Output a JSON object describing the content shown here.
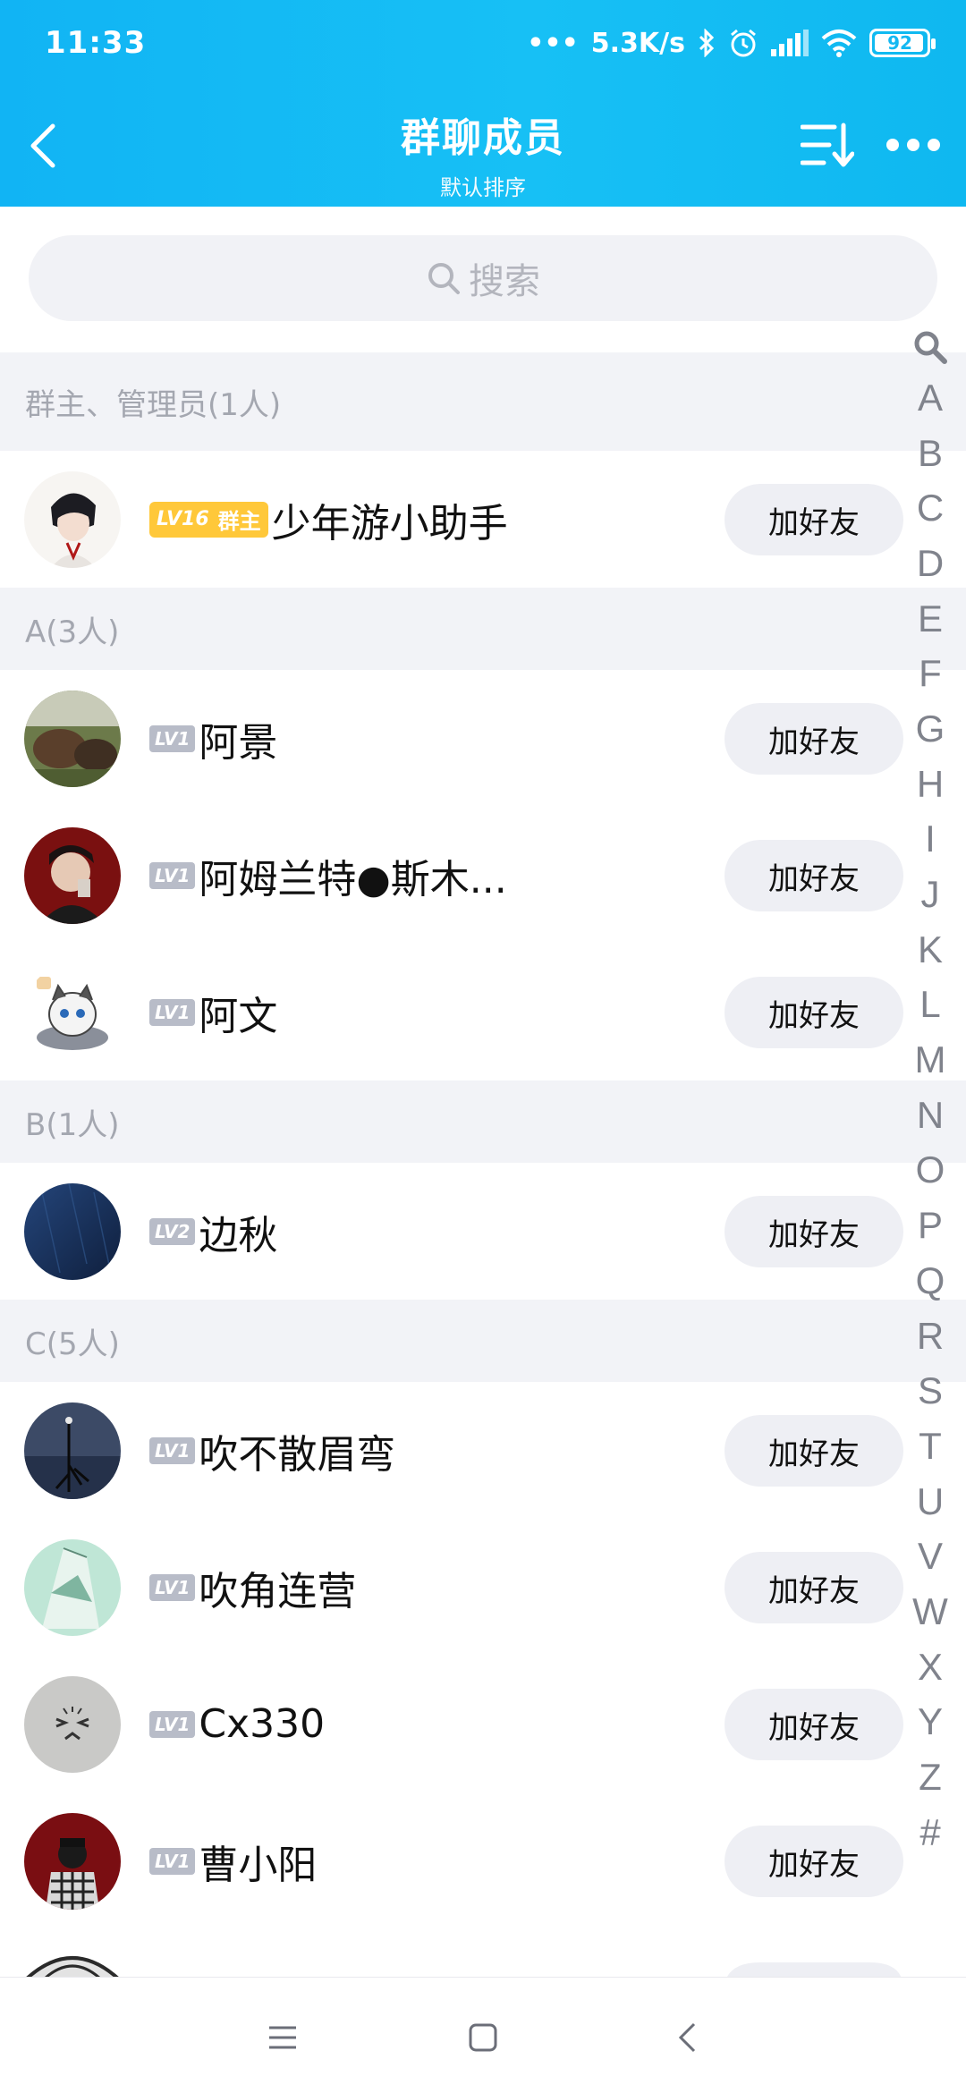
{
  "status_bar": {
    "time": "11:33",
    "network_speed": "5.3K/s",
    "battery": "92"
  },
  "header": {
    "title": "群聊成员",
    "subtitle": "默认排序"
  },
  "search": {
    "placeholder": "搜索"
  },
  "sections": {
    "admins": {
      "title": "群主、管理员(1人)",
      "members": [
        {
          "level": "LV16",
          "role": "群主",
          "name": "少年游小助手",
          "action": "加好友"
        }
      ]
    },
    "a": {
      "title": "A(3人)",
      "members": [
        {
          "level": "LV1",
          "name": "阿景",
          "action": "加好友"
        },
        {
          "level": "LV1",
          "name": "阿姆兰特●斯木...",
          "action": "加好友"
        },
        {
          "level": "LV1",
          "name": "阿文",
          "action": "加好友"
        }
      ]
    },
    "b": {
      "title": "B(1人)",
      "members": [
        {
          "level": "LV2",
          "name": "边秋",
          "action": "加好友"
        }
      ]
    },
    "c": {
      "title": "C(5人)",
      "members": [
        {
          "level": "LV1",
          "name": "吹不散眉弯",
          "action": "加好友"
        },
        {
          "level": "LV1",
          "name": "吹角连营",
          "action": "加好友"
        },
        {
          "level": "LV1",
          "name": "Cx330",
          "action": "加好友"
        },
        {
          "level": "LV1",
          "name": "曹小阳",
          "action": "加好友"
        }
      ]
    }
  },
  "alpha_index": [
    "A",
    "B",
    "C",
    "D",
    "E",
    "F",
    "G",
    "H",
    "I",
    "J",
    "K",
    "L",
    "M",
    "N",
    "O",
    "P",
    "Q",
    "R",
    "S",
    "T",
    "U",
    "V",
    "W",
    "X",
    "Y",
    "Z",
    "#"
  ],
  "colors": {
    "header_gradient_start": "#11b4f4",
    "owner_badge": "#ffc83a",
    "level_badge": "#b8bcc8",
    "section_bg": "#f2f3f7"
  }
}
